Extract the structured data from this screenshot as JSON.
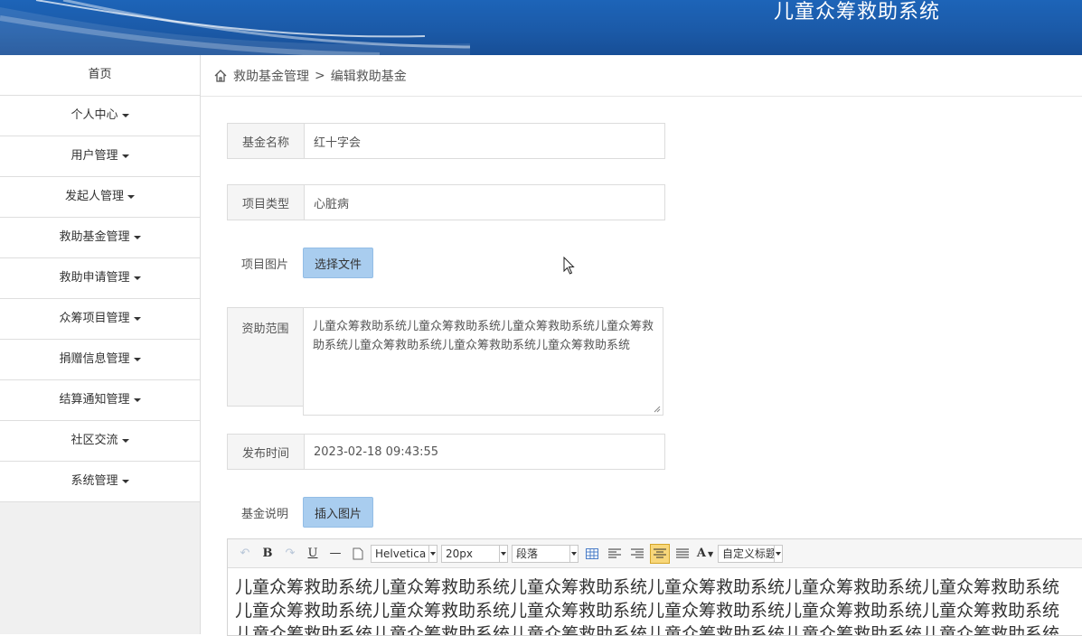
{
  "header": {
    "title": "儿童众筹救助系统"
  },
  "sidebar": {
    "items": [
      {
        "label": "首页",
        "dropdown": false
      },
      {
        "label": "个人中心",
        "dropdown": true
      },
      {
        "label": "用户管理",
        "dropdown": true
      },
      {
        "label": "发起人管理",
        "dropdown": true
      },
      {
        "label": "救助基金管理",
        "dropdown": true
      },
      {
        "label": "救助申请管理",
        "dropdown": true
      },
      {
        "label": "众筹项目管理",
        "dropdown": true
      },
      {
        "label": "捐赠信息管理",
        "dropdown": true
      },
      {
        "label": "结算通知管理",
        "dropdown": true
      },
      {
        "label": "社区交流",
        "dropdown": true
      },
      {
        "label": "系统管理",
        "dropdown": true
      }
    ]
  },
  "breadcrumb": {
    "parent": "救助基金管理",
    "separator": ">",
    "current": "编辑救助基金"
  },
  "form": {
    "fund_name": {
      "label": "基金名称",
      "value": "红十字会"
    },
    "project_type": {
      "label": "项目类型",
      "value": "心脏病"
    },
    "project_image": {
      "label": "项目图片",
      "button": "选择文件"
    },
    "scope": {
      "label": "资助范围",
      "value": "儿童众筹救助系统儿童众筹救助系统儿童众筹救助系统儿童众筹救助系统儿童众筹救助系统儿童众筹救助系统儿童众筹救助系统"
    },
    "publish_time": {
      "label": "发布时间",
      "value": "2023-02-18 09:43:55"
    },
    "description": {
      "label": "基金说明",
      "button": "插入图片"
    }
  },
  "editor": {
    "font_family": "Helvetica I",
    "font_size": "20px",
    "paragraph": "段落",
    "custom_heading": "自定义标题",
    "lines": [
      "儿童众筹救助系统儿童众筹救助系统儿童众筹救助系统儿童众筹救助系统儿童众筹救助系统儿童众筹救助系统",
      "儿童众筹救助系统儿童众筹救助系统儿童众筹救助系统儿童众筹救助系统儿童众筹救助系统儿童众筹救助系统",
      "儿童众筹救助系统儿童众筹救助系统儿童众筹救助系统儿童众筹救助系统儿童众筹救助系统儿童众筹救助系统"
    ]
  },
  "colors": {
    "header_blue": "#1b5aa8",
    "button_blue": "#a9cdef",
    "active_tool": "#f8d77a"
  }
}
